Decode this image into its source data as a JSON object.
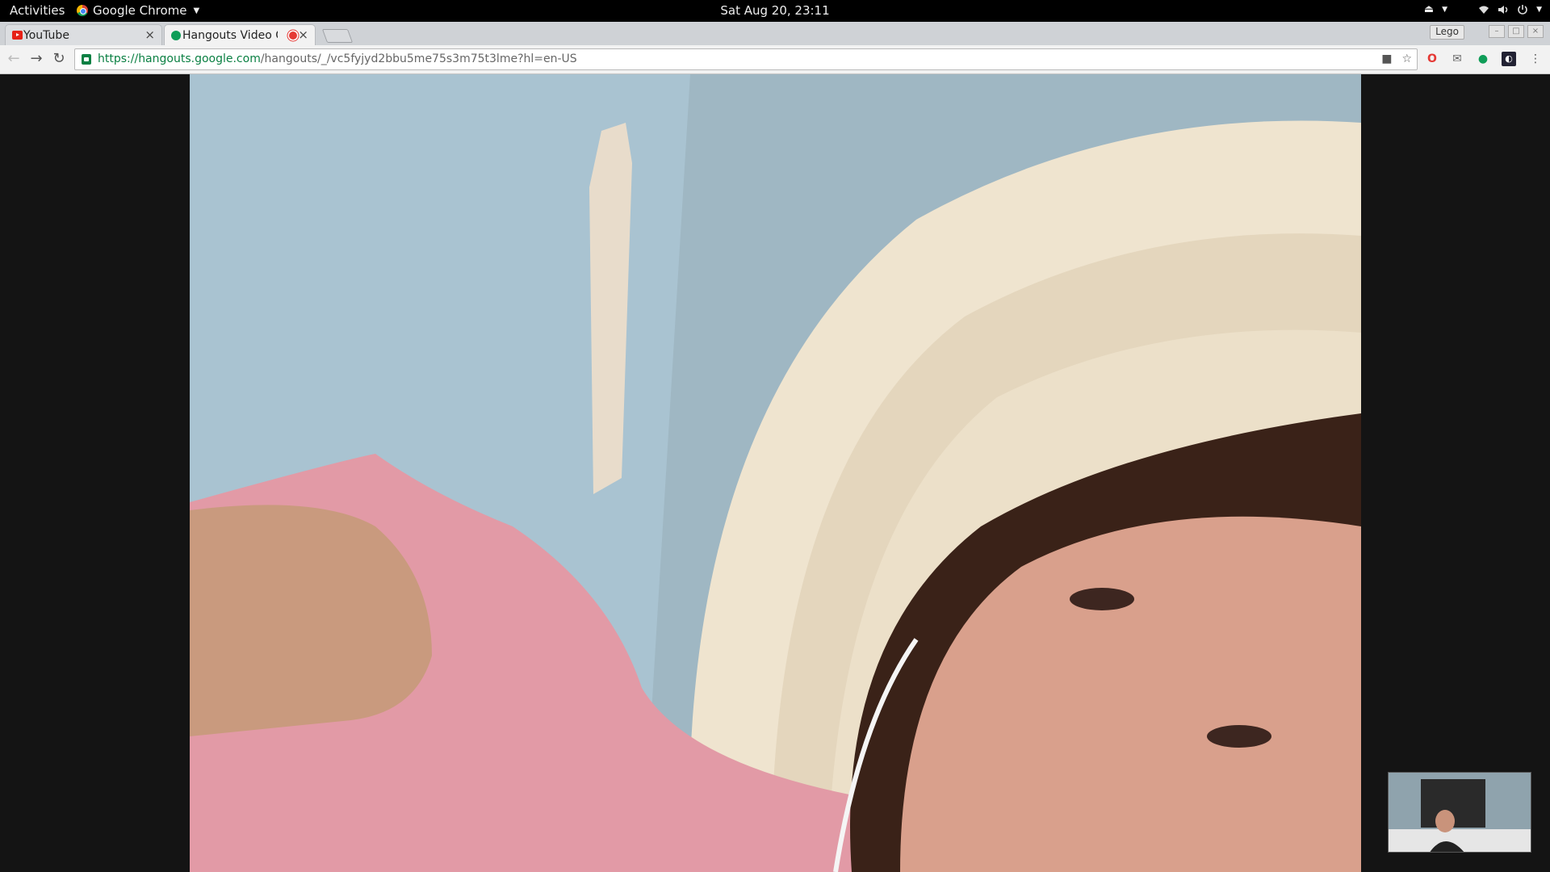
{
  "topbar": {
    "activities": "Activities",
    "app_name": "Google Chrome",
    "clock": "Sat Aug 20, 23:11"
  },
  "tabs": [
    {
      "title": "YouTube",
      "active": false
    },
    {
      "title": "Hangouts Video C",
      "active": true,
      "recording": true
    }
  ],
  "profile_name": "Lego",
  "omnibox": {
    "scheme": "https://",
    "host": "hangouts.google.com",
    "path": "/hangouts/_/vc5fyjyd2bbu5me75s3m75t3lme?hl=en-US"
  },
  "colors": {
    "secure_green": "#0b8043",
    "recording_red": "#e53935",
    "youtube_red": "#e62117",
    "hangouts_green": "#0f9d58"
  },
  "icons": {
    "back": "arrow-left-icon",
    "forward": "arrow-right-icon",
    "reload": "reload-icon",
    "camera": "camera-icon",
    "bookmark": "star-icon",
    "menu": "kebab-menu-icon"
  }
}
